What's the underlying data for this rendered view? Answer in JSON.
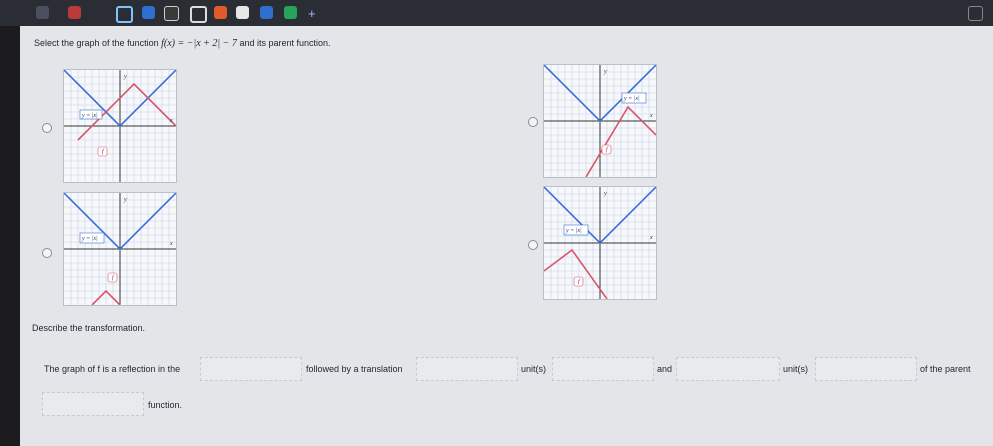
{
  "question": {
    "prefix": "Select the graph of the function",
    "function_expr": "f(x) = −|x + 2| − 7",
    "suffix": "and its parent function."
  },
  "graph_labels": {
    "parent": "y = |x|",
    "child": "f",
    "axis_x": "x",
    "axis_y": "y"
  },
  "describe_label": "Describe the transformation.",
  "statement": {
    "part1": "The graph of f is a reflection in the",
    "part2": "followed by a translation",
    "part3": "unit(s)",
    "part4": "and",
    "part5": "unit(s)",
    "part6": "of the parent",
    "part7": "function."
  },
  "colors": {
    "parent": "#3a6fd8",
    "child": "#d9546a",
    "grid": "#c9d4e3",
    "axis": "#333333"
  }
}
